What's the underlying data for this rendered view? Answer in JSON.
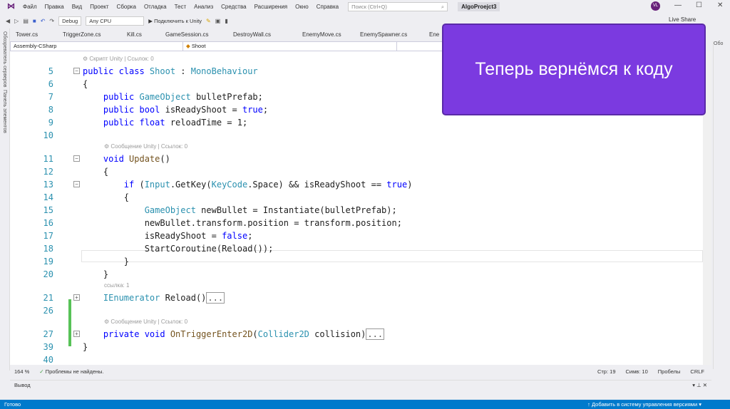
{
  "menu": {
    "items": [
      "Файл",
      "Правка",
      "Вид",
      "Проект",
      "Сборка",
      "Отладка",
      "Тест",
      "Анализ",
      "Средства",
      "Расширения",
      "Окно",
      "Справка"
    ],
    "search_placeholder": "Поиск (Ctrl+Q)",
    "project": "AlgoProejct3",
    "avatar": "VL"
  },
  "toolbar": {
    "config": "Debug",
    "platform": "Any CPU",
    "attach": "▶ Подключить к Unity",
    "live_share": "Live Share"
  },
  "left_tabs": [
    "Обозреватель серверов",
    "Панель элементов"
  ],
  "doc_tabs": [
    "Tower.cs",
    "TriggerZone.cs",
    "Kill.cs",
    "GameSession.cs",
    "DestroyWall.cs",
    "EnemyMove.cs",
    "EnemySpawner.cs",
    "Ene"
  ],
  "navbar": {
    "project": "Assembly-CSharp",
    "class": "Shoot"
  },
  "right_panel": "Обо",
  "code": [
    {
      "lens": "⚙ Скрипт Unity | Ссылок: 0"
    },
    {
      "n": "5",
      "fold": "−",
      "tokens": [
        [
          "kw",
          "public class "
        ],
        [
          "ty",
          "Shoot"
        ],
        [
          "pl",
          " : "
        ],
        [
          "ty",
          "MonoBehaviour"
        ]
      ]
    },
    {
      "n": "6",
      "tokens": [
        [
          "pl",
          "{"
        ]
      ]
    },
    {
      "n": "7",
      "tokens": [
        [
          "kw",
          "    public "
        ],
        [
          "ty",
          "GameObject"
        ],
        [
          "pl",
          " bulletPrefab;"
        ]
      ]
    },
    {
      "n": "8",
      "tokens": [
        [
          "kw",
          "    public bool"
        ],
        [
          "pl",
          " isReadyShoot = "
        ],
        [
          "kw",
          "true"
        ],
        [
          "pl",
          ";"
        ]
      ]
    },
    {
      "n": "9",
      "tokens": [
        [
          "kw",
          "    public float"
        ],
        [
          "pl",
          " reloadTime = 1;"
        ]
      ]
    },
    {
      "n": "10",
      "tokens": []
    },
    {
      "lens": "⚙ Сообщение Unity | Ссылок: 0",
      "indent": 4
    },
    {
      "n": "11",
      "fold": "−",
      "tokens": [
        [
          "kw",
          "    void "
        ],
        [
          "mt",
          "Update"
        ],
        [
          "pl",
          "()"
        ]
      ]
    },
    {
      "n": "12",
      "tokens": [
        [
          "pl",
          "    {"
        ]
      ]
    },
    {
      "n": "13",
      "fold": "−",
      "tokens": [
        [
          "kw",
          "        if"
        ],
        [
          "pl",
          " ("
        ],
        [
          "ty",
          "Input"
        ],
        [
          "pl",
          ".GetKey("
        ],
        [
          "ty",
          "KeyCode"
        ],
        [
          "pl",
          ".Space) && isReadyShoot == "
        ],
        [
          "kw",
          "true"
        ],
        [
          "pl",
          ")"
        ]
      ]
    },
    {
      "n": "14",
      "tokens": [
        [
          "pl",
          "        {"
        ]
      ]
    },
    {
      "n": "15",
      "tokens": [
        [
          "ty",
          "            GameObject"
        ],
        [
          "pl",
          " newBullet = Instantiate(bulletPrefab);"
        ]
      ]
    },
    {
      "n": "16",
      "tokens": [
        [
          "pl",
          "            newBullet.transform.position = transform.position;"
        ]
      ]
    },
    {
      "n": "17",
      "tokens": [
        [
          "pl",
          "            isReadyShoot = "
        ],
        [
          "kw",
          "false"
        ],
        [
          "pl",
          ";"
        ]
      ]
    },
    {
      "n": "18",
      "tokens": [
        [
          "pl",
          "            StartCoroutine(Reload());"
        ]
      ]
    },
    {
      "n": "19",
      "tokens": [
        [
          "pl",
          "        }"
        ]
      ]
    },
    {
      "n": "20",
      "tokens": [
        [
          "pl",
          "    }"
        ]
      ]
    },
    {
      "lens": "ссылка: 1",
      "indent": 4
    },
    {
      "n": "21",
      "fold": "+",
      "tokens": [
        [
          "ty",
          "    IEnumerator"
        ],
        [
          "pl",
          " Reload()"
        ]
      ],
      "collapsed": "..."
    },
    {
      "n": "26",
      "tokens": []
    },
    {
      "lens": "⚙ Сообщение Unity | Ссылок: 0",
      "indent": 4
    },
    {
      "n": "27",
      "fold": "+",
      "tokens": [
        [
          "kw",
          "    private void "
        ],
        [
          "mt",
          "OnTriggerEnter2D"
        ],
        [
          "pl",
          "("
        ],
        [
          "ty",
          "Collider2D"
        ],
        [
          "pl",
          " collision)"
        ]
      ],
      "collapsed": "..."
    },
    {
      "n": "39",
      "tokens": [
        [
          "pl",
          "}"
        ]
      ]
    },
    {
      "n": "40",
      "tokens": []
    }
  ],
  "status": {
    "zoom": "164 %",
    "problems": "Проблемы не найдены.",
    "line": "Стр: 19",
    "col": "Симв: 10",
    "spaces": "Пробелы",
    "eol": "CRLF"
  },
  "output": {
    "title": "Вывод"
  },
  "statusbar": {
    "ready": "Готово",
    "vcs": "↑ Добавить в систему управления версиями ▾"
  },
  "overlay": {
    "text": "Теперь вернёмся к коду"
  },
  "colors": {
    "accent": "#7b3ae0",
    "statusbar": "#007acc",
    "keyword": "#0000ff",
    "type": "#2b91af"
  }
}
